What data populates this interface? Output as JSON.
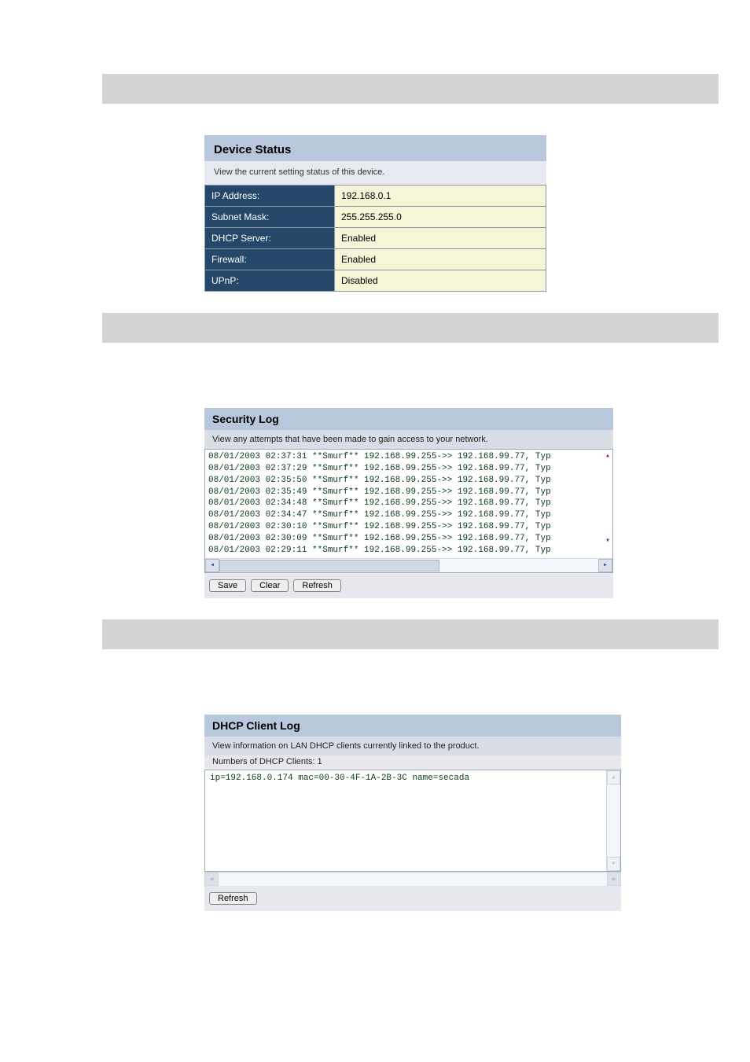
{
  "device_status": {
    "title": "Device Status",
    "subtitle": "View the current setting status of this device.",
    "rows": [
      {
        "label": "IP Address:",
        "value": "192.168.0.1"
      },
      {
        "label": "Subnet Mask:",
        "value": "255.255.255.0"
      },
      {
        "label": "DHCP Server:",
        "value": "Enabled"
      },
      {
        "label": "Firewall:",
        "value": "Enabled"
      },
      {
        "label": "UPnP:",
        "value": "Disabled"
      }
    ]
  },
  "security_log": {
    "title": "Security Log",
    "subtitle": "View any attempts that have been made to gain access to your network.",
    "lines": [
      "08/01/2003  02:37:31 **Smurf** 192.168.99.255->> 192.168.99.77, Typ",
      "08/01/2003  02:37:29 **Smurf** 192.168.99.255->> 192.168.99.77, Typ",
      "08/01/2003  02:35:50 **Smurf** 192.168.99.255->> 192.168.99.77, Typ",
      "08/01/2003  02:35:49 **Smurf** 192.168.99.255->> 192.168.99.77, Typ",
      "08/01/2003  02:34:48 **Smurf** 192.168.99.255->> 192.168.99.77, Typ",
      "08/01/2003  02:34:47 **Smurf** 192.168.99.255->> 192.168.99.77, Typ",
      "08/01/2003  02:30:10 **Smurf** 192.168.99.255->> 192.168.99.77, Typ",
      "08/01/2003  02:30:09 **Smurf** 192.168.99.255->> 192.168.99.77, Typ",
      "08/01/2003  02:29:11 **Smurf** 192.168.99.255->> 192.168.99.77, Typ"
    ],
    "buttons": {
      "save": "Save",
      "clear": "Clear",
      "refresh": "Refresh"
    }
  },
  "dhcp_client_log": {
    "title": "DHCP Client Log",
    "subtitle": "View information on LAN DHCP clients currently linked to the product.",
    "count_label": "Numbers of DHCP Clients: 1",
    "line": "ip=192.168.0.174    mac=00-30-4F-1A-2B-3C         name=secada",
    "buttons": {
      "refresh": "Refresh"
    }
  }
}
